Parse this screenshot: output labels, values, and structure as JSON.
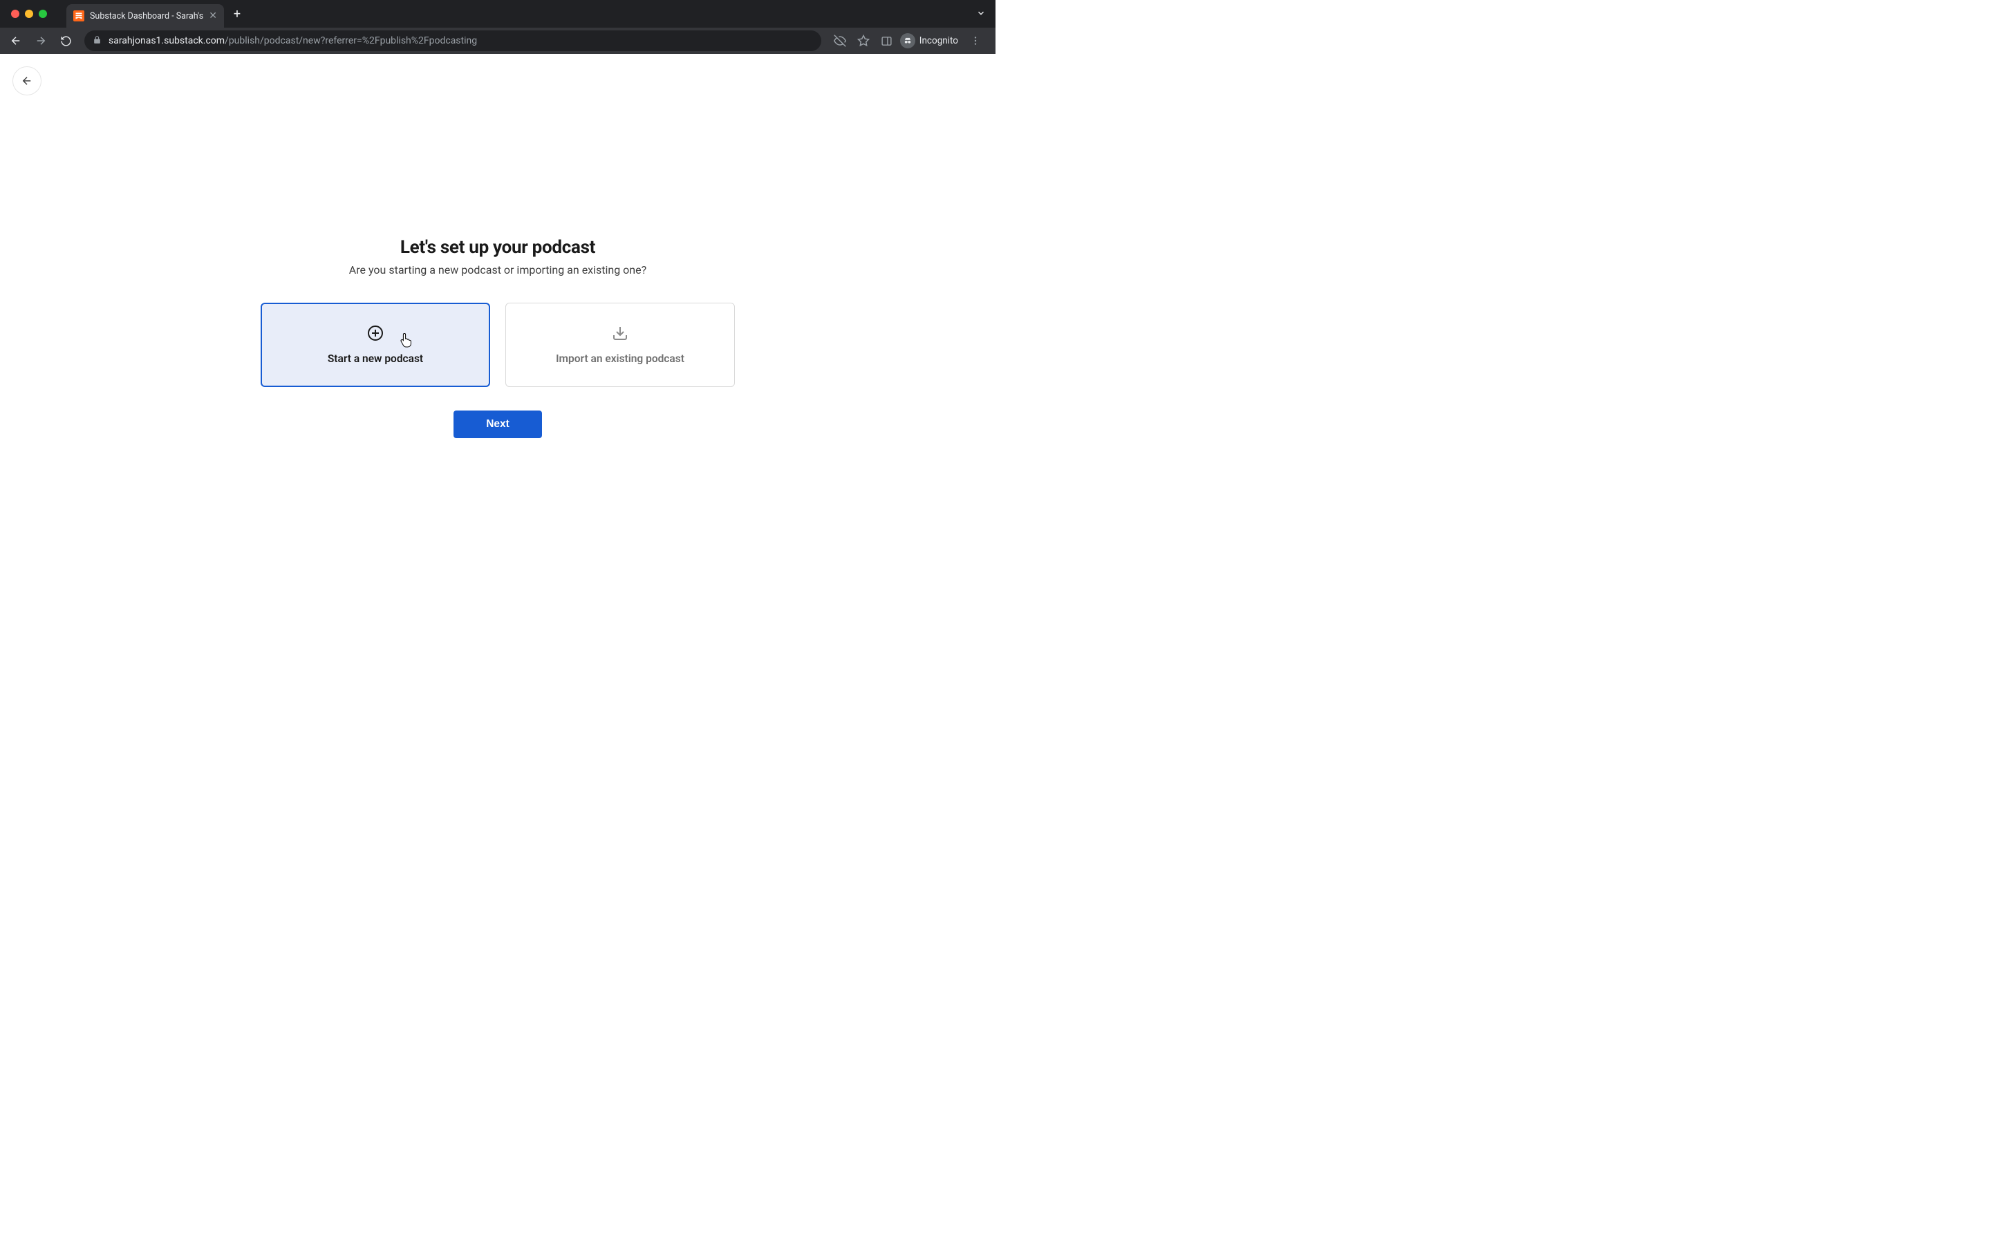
{
  "browser": {
    "tab_title": "Substack Dashboard - Sarah's",
    "url_host": "sarahjonas1.substack.com",
    "url_path": "/publish/podcast/new?referrer=%2Fpublish%2Fpodcasting",
    "incognito_label": "Incognito"
  },
  "page": {
    "heading": "Let's set up your podcast",
    "subheading": "Are you starting a new podcast or importing an existing one?",
    "options": {
      "start_new_label": "Start a new podcast",
      "import_existing_label": "Import an existing podcast"
    },
    "next_button_label": "Next"
  }
}
